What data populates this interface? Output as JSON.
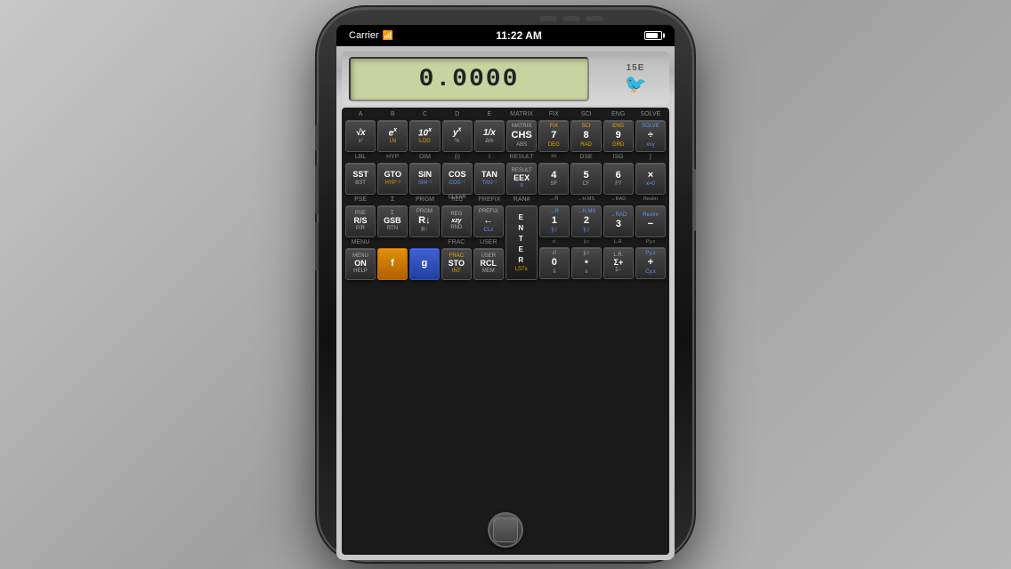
{
  "status": {
    "carrier": "Carrier",
    "time": "11:22 AM",
    "battery": "100"
  },
  "display": {
    "value": "0.0000",
    "model": "15E"
  },
  "rows": [
    {
      "id": "row1",
      "col_labels": [
        "A",
        "B",
        "C",
        "D",
        "E",
        "MATRIX",
        "FIX",
        "SCI",
        "ENG",
        "SOLVE"
      ],
      "buttons": [
        {
          "top": "A",
          "main": "√x",
          "main_style": "math",
          "sub": "x²"
        },
        {
          "top": "B",
          "main": "eˣ",
          "main_style": "math",
          "sub": "LN",
          "sub_style": "orange"
        },
        {
          "top": "C",
          "main": "10ˣ",
          "main_style": "math",
          "sub": "LOG",
          "sub_style": "orange"
        },
        {
          "top": "D",
          "main": "yˣ",
          "main_style": "math",
          "sub": "%"
        },
        {
          "top": "E",
          "main": "1/x",
          "main_style": "math",
          "sub": "Δ%"
        },
        {
          "top": "MATRIX",
          "main": "CHS",
          "sub": "ABS"
        },
        {
          "top": "FIX",
          "main": "7",
          "sub": "DEG",
          "sub_style": "orange"
        },
        {
          "top": "SCI",
          "main": "8",
          "sub": "RAD",
          "sub_style": "orange"
        },
        {
          "top": "ENG",
          "main": "9",
          "sub": "GRD",
          "sub_style": "orange"
        },
        {
          "top": "SOLVE",
          "main": "÷",
          "sub": "x≤y",
          "sub_style": "blue"
        }
      ]
    },
    {
      "id": "row2",
      "col_labels": [
        "LBL",
        "HYP",
        "DIM",
        "(i)",
        "I",
        "RESULT",
        "xz",
        "DSE",
        "ISG",
        "∫"
      ],
      "buttons": [
        {
          "top": "LBL",
          "main": "SST",
          "sub": "BST"
        },
        {
          "top": "HYP",
          "main": "GTO",
          "sub": "HYP⁻¹",
          "sub_style": "orange"
        },
        {
          "top": "DIM",
          "main": "SIN",
          "main_style": "math",
          "sub": "SIN⁻¹",
          "sub_style": "blue"
        },
        {
          "top": "(i)",
          "main": "COS",
          "main_style": "math",
          "sub": "COS⁻¹",
          "sub_style": "blue"
        },
        {
          "top": "I",
          "main": "TAN",
          "main_style": "math",
          "sub": "TAN⁻¹",
          "sub_style": "blue"
        },
        {
          "top": "RESULT",
          "main": "EEX",
          "sub": "π",
          "sub_style": "blue"
        },
        {
          "top": "xz",
          "main": "4",
          "sub": "SF"
        },
        {
          "top": "DSE",
          "main": "5",
          "sub": "CF"
        },
        {
          "top": "ISG",
          "main": "6",
          "sub": "F?"
        },
        {
          "top": "∫",
          "main": "×",
          "sub": "x=0",
          "sub_style": "blue"
        }
      ]
    },
    {
      "id": "row3",
      "col_labels": [
        "PSE",
        "Σ",
        "PRGM",
        "REG",
        "PREFIX",
        "RAN#",
        "→R",
        "→H.MS",
        "→RAD",
        "Re≤Im"
      ],
      "buttons": [
        {
          "top": "PSE",
          "main": "R/S",
          "sub": "P/R"
        },
        {
          "top": "Σ",
          "main": "GSB",
          "sub": "RTN"
        },
        {
          "top": "PRGM",
          "main": "R↓",
          "sub": "R↑"
        },
        {
          "top": "REG",
          "main": "xzy",
          "main_style": "math",
          "sub": "RND"
        },
        {
          "top": "PREFIX",
          "main": "←",
          "sub": "CLx",
          "sub_style": "blue"
        },
        {
          "top": "RAN#",
          "main": "",
          "is_enter": true,
          "enter_text": "E\nN\nT\nE\nR",
          "sub": "LSTx"
        },
        {
          "top": "→R",
          "main": "1",
          "sub": "ŷ,r",
          "sub_style": "blue"
        },
        {
          "top": "→H.MS",
          "main": "2",
          "sub": "ŷ,r",
          "sub_style": "blue"
        },
        {
          "top": "→RAD",
          "main": "3",
          "sub": "",
          "sub_style": ""
        },
        {
          "top": "Re≤Im",
          "main": "−",
          "sub": "",
          "sub_style": ""
        }
      ]
    },
    {
      "id": "row4",
      "col_labels": [
        "MENU",
        "",
        "",
        "FRAC",
        "USER",
        "",
        "x!",
        "ŷ,r",
        "L.R.",
        "Py,x"
      ],
      "buttons": [
        {
          "top": "MENU",
          "main": "ON",
          "sub": "HELP"
        },
        {
          "top": "",
          "main": "f",
          "main_style": "orange_btn"
        },
        {
          "top": "",
          "main": "g",
          "main_style": "blue_btn"
        },
        {
          "top": "FRAC",
          "main": "STO",
          "sub": "INT",
          "sub_style": "orange"
        },
        {
          "top": "USER",
          "main": "RCL",
          "sub": "MEM"
        },
        {
          "top": "",
          "main": "",
          "is_enter_bot": true,
          "enter_sub": "LSTx"
        },
        {
          "top": "x!",
          "main": "0",
          "sub": "x̄"
        },
        {
          "top": "ŷ,r",
          "main": "•",
          "sub": "s"
        },
        {
          "top": "L.R.",
          "main": "Σ+",
          "sub": "Σ−"
        },
        {
          "top": "Py,x",
          "main": "+",
          "sub": "Cy,x",
          "sub_style": "blue"
        }
      ]
    }
  ]
}
